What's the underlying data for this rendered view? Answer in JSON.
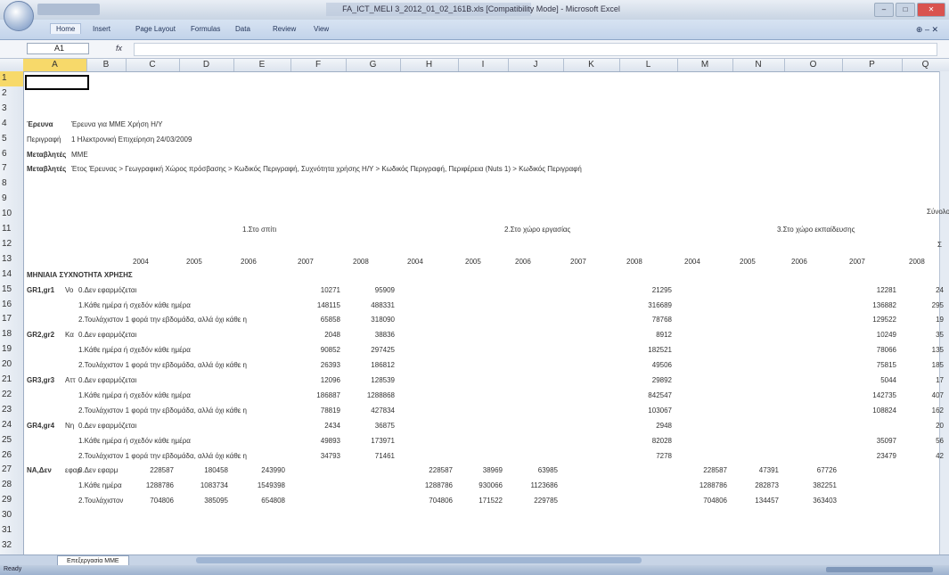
{
  "window": {
    "title": "FA_ICT_MELI 3_2012_01_02_161B.xls [Compatibility Mode] - Microsoft Excel",
    "buttons": {
      "minimize": "–",
      "maximize": "□",
      "close": "✕"
    }
  },
  "ribbon": {
    "tabs": [
      "Home",
      "Insert",
      "Page Layout",
      "Formulas",
      "Data",
      "Review",
      "View"
    ],
    "right_controls": "⊕ – ✕"
  },
  "formula_bar": {
    "name_box": "A1",
    "fx": "fx",
    "value": ""
  },
  "columns": [
    "A",
    "B",
    "C",
    "D",
    "E",
    "F",
    "G",
    "H",
    "I",
    "J",
    "K",
    "L",
    "M",
    "N",
    "O",
    "P",
    "Q"
  ],
  "rows": [
    "1",
    "2",
    "3",
    "4",
    "5",
    "6",
    "7",
    "8",
    "9",
    "10",
    "11",
    "12",
    "13",
    "14",
    "15",
    "16",
    "17",
    "18",
    "19",
    "20",
    "21",
    "22",
    "23",
    "24",
    "25",
    "26",
    "27",
    "28",
    "29",
    "30",
    "31",
    "32"
  ],
  "meta": {
    "r4_label": "Έρευνα",
    "r4_value": "Έρευνα για ΜΜΕ Χρήση Η/Υ",
    "r5_label": "Περιγραφή",
    "r5_value": "1 Ηλεκτρονική Επιχείρηση 24/03/2009",
    "r6_label": "Μεταβλητές",
    "r6_value": "ΜΜΕ",
    "r7_label": "Μεταβλητές",
    "r7_value": "Έτος Έρευνας > Γεωγραφική Χώρος πρόσβασης > Κωδικός Περιγραφή, Συχνότητα χρήσης Η/Υ > Κωδικός Περιγραφή, Περιφέρεια (Nuts 1) > Κωδικός Περιγραφή"
  },
  "section_headers": [
    "1.Στο σπίτι",
    "2.Στο χώρο εργασίας",
    "3.Στο χώρο εκπαίδευσης"
  ],
  "r10_right": "Σύνολο",
  "r12_right": "Σ",
  "years": {
    "c": "2004",
    "d": "2005",
    "e": "2006",
    "f": "2007",
    "g": "2008",
    "h": "2004",
    "i": "2005",
    "j": "2006",
    "k": "2007",
    "l": "2008",
    "m": "2004",
    "n": "2005",
    "o": "2006",
    "p": "2007",
    "q": "2008"
  },
  "r14_label": "ΜΗΝΙΑΙΑ ΣΥΧΝΟΤΗΤΑ ΧΡΗΣΗΣ",
  "data_rows": [
    {
      "row": "15",
      "a": "GR1,gr1",
      "ah": "Vo",
      "b": "0.Δεν εφαρμόζεται",
      "c": "",
      "d": "",
      "e": "",
      "f": "10271",
      "g": "95909",
      "h": "",
      "i": "",
      "j": "",
      "l": "21295",
      "m": "",
      "n": "",
      "o": "",
      "p": "12281",
      "q": "24"
    },
    {
      "row": "16",
      "a": "",
      "ah": "",
      "b": "1.Κάθε ημέρα ή σχεδόν κάθε ημέρα",
      "c": "",
      "d": "",
      "e": "",
      "f": "148115",
      "g": "488331",
      "h": "",
      "i": "",
      "j": "",
      "l": "316689",
      "m": "",
      "n": "",
      "o": "",
      "p": "136882",
      "q": "295"
    },
    {
      "row": "17",
      "a": "",
      "ah": "",
      "b": "2.Τουλάχιστον 1 φορά την εβδομάδα, αλλά όχι κάθε η",
      "c": "",
      "d": "",
      "e": "",
      "f": "65858",
      "g": "318090",
      "h": "",
      "i": "",
      "j": "",
      "l": "78768",
      "m": "",
      "n": "",
      "o": "",
      "p": "129522",
      "q": "19"
    },
    {
      "row": "18",
      "a": "GR2,gr2",
      "ah": "Κα",
      "b": "0.Δεν εφαρμόζεται",
      "c": "",
      "d": "",
      "e": "",
      "f": "2048",
      "g": "38836",
      "h": "",
      "i": "",
      "j": "",
      "l": "8912",
      "m": "",
      "n": "",
      "o": "",
      "p": "10249",
      "q": "35"
    },
    {
      "row": "19",
      "a": "",
      "ah": "",
      "b": "1.Κάθε ημέρα ή σχεδόν κάθε ημέρα",
      "c": "",
      "d": "",
      "e": "",
      "f": "90852",
      "g": "297425",
      "h": "",
      "i": "",
      "j": "",
      "l": "182521",
      "m": "",
      "n": "",
      "o": "",
      "p": "78066",
      "q": "135"
    },
    {
      "row": "20",
      "a": "",
      "ah": "",
      "b": "2.Τουλάχιστον 1 φορά την εβδομάδα, αλλά όχι κάθε η",
      "c": "",
      "d": "",
      "e": "",
      "f": "26393",
      "g": "186812",
      "h": "",
      "i": "",
      "j": "",
      "l": "49506",
      "m": "",
      "n": "",
      "o": "",
      "p": "75815",
      "q": "185"
    },
    {
      "row": "21",
      "a": "GR3,gr3",
      "ah": "Αττ",
      "b": "0.Δεν εφαρμόζεται",
      "c": "",
      "d": "",
      "e": "",
      "f": "12096",
      "g": "128539",
      "h": "",
      "i": "",
      "j": "",
      "l": "29892",
      "m": "",
      "n": "",
      "o": "",
      "p": "5044",
      "q": "17"
    },
    {
      "row": "22",
      "a": "",
      "ah": "",
      "b": "1.Κάθε ημέρα ή σχεδόν κάθε ημέρα",
      "c": "",
      "d": "",
      "e": "",
      "f": "186887",
      "g": "1288868",
      "h": "",
      "i": "",
      "j": "",
      "l": "842547",
      "m": "",
      "n": "",
      "o": "",
      "p": "142735",
      "q": "407"
    },
    {
      "row": "23",
      "a": "",
      "ah": "",
      "b": "2.Τουλάχιστον 1 φορά την εβδομάδα, αλλά όχι κάθε η",
      "c": "",
      "d": "",
      "e": "",
      "f": "78819",
      "g": "427834",
      "h": "",
      "i": "",
      "j": "",
      "l": "103067",
      "m": "",
      "n": "",
      "o": "",
      "p": "108824",
      "q": "162"
    },
    {
      "row": "24",
      "a": "GR4,gr4",
      "ah": "Νη",
      "b": "0.Δεν εφαρμόζεται",
      "c": "",
      "d": "",
      "e": "",
      "f": "2434",
      "g": "36875",
      "h": "",
      "i": "",
      "j": "",
      "l": "2948",
      "m": "",
      "n": "",
      "o": "",
      "p": "",
      "q": "20"
    },
    {
      "row": "25",
      "a": "",
      "ah": "",
      "b": "1.Κάθε ημέρα ή σχεδόν κάθε ημέρα",
      "c": "",
      "d": "",
      "e": "",
      "f": "49893",
      "g": "173971",
      "h": "",
      "i": "",
      "j": "",
      "l": "82028",
      "m": "",
      "n": "",
      "o": "",
      "p": "35097",
      "q": "56"
    },
    {
      "row": "26",
      "a": "",
      "ah": "",
      "b": "2.Τουλάχιστον 1 φορά την εβδομάδα, αλλά όχι κάθε η",
      "c": "",
      "d": "",
      "e": "",
      "f": "34793",
      "g": "71461",
      "h": "",
      "i": "",
      "j": "",
      "l": "7278",
      "m": "",
      "n": "",
      "o": "",
      "p": "23479",
      "q": "42"
    },
    {
      "row": "27",
      "a": "ΝΑ,Δεν",
      "ah": "εφαρ",
      "b": "0.Δεν εφαρμ",
      "c": "228587",
      "d": "180458",
      "e": "243990",
      "f": "",
      "g": "",
      "h": "228587",
      "i": "38969",
      "j": "63985",
      "l": "",
      "m": "228587",
      "n": "47391",
      "o": "67726",
      "p": "",
      "q": ""
    },
    {
      "row": "28",
      "a": "",
      "ah": "",
      "b": "1.Κάθε ημέρα",
      "c": "1288786",
      "d": "1083734",
      "e": "1549398",
      "f": "",
      "g": "",
      "h": "1288786",
      "i": "930066",
      "j": "1123686",
      "l": "",
      "m": "1288786",
      "n": "282873",
      "o": "382251",
      "p": "",
      "q": ""
    },
    {
      "row": "29",
      "a": "",
      "ah": "",
      "b": "2.Τουλάχιστον",
      "c": "704806",
      "d": "385095",
      "e": "654808",
      "f": "",
      "g": "",
      "h": "704806",
      "i": "171522",
      "j": "229785",
      "l": "",
      "m": "704806",
      "n": "134457",
      "o": "363403",
      "p": "",
      "q": ""
    }
  ],
  "sheet_tab": "Επεξεργασία ΜΜΕ",
  "status": "Ready"
}
